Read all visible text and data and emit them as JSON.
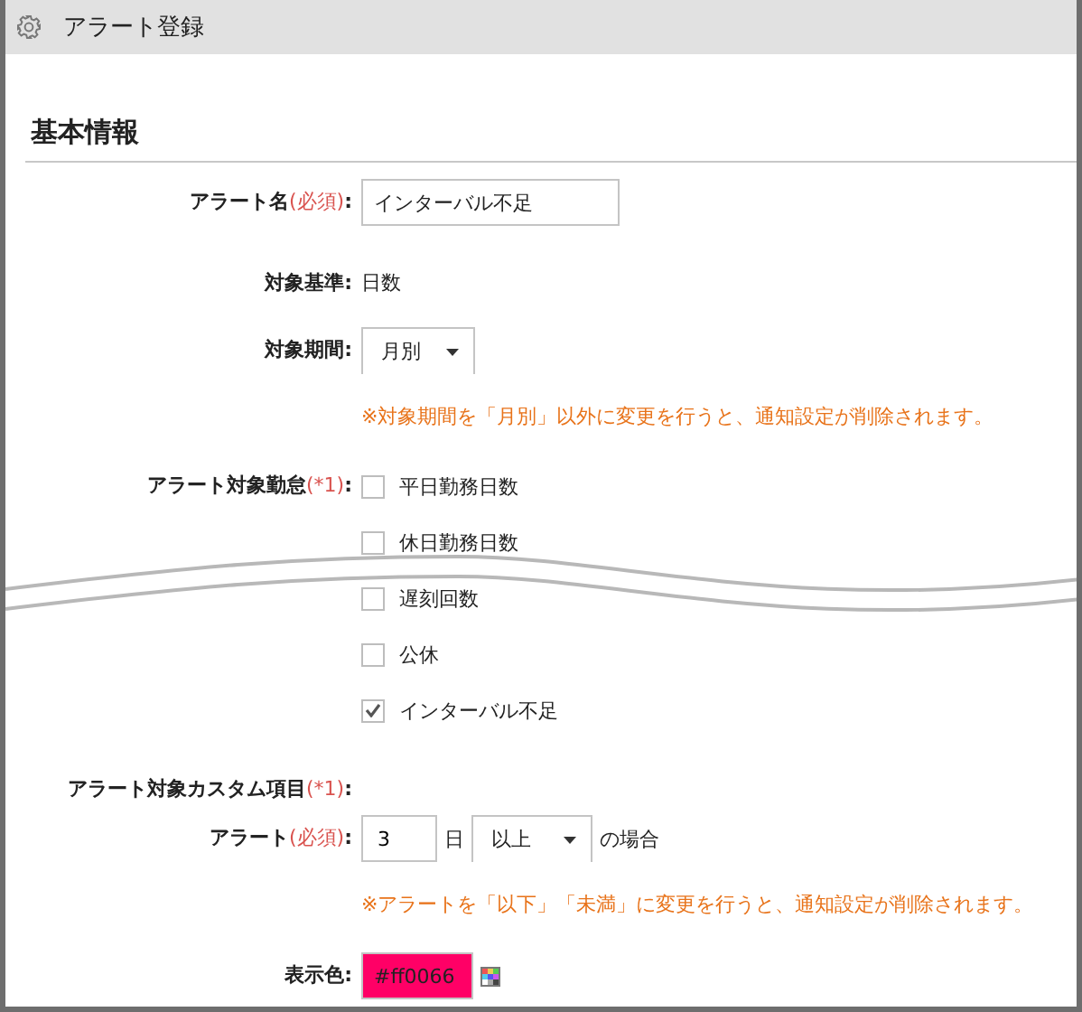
{
  "window": {
    "title": "アラート登録"
  },
  "section": {
    "title": "基本情報"
  },
  "rows": [
    {
      "kind": "input",
      "label": "アラート名",
      "required": "(必須)",
      "separator": ":",
      "value": "インターバル不足"
    },
    {
      "kind": "static",
      "label": "対象基準",
      "separator": ":",
      "value": "日数"
    },
    {
      "kind": "select",
      "label": "対象期間",
      "separator": ":",
      "value": "月別"
    },
    {
      "kind": "note",
      "text": "※対象期間を「月別」以外に変更を行うと、通知設定が削除されます。"
    },
    {
      "kind": "checkboxes",
      "label": "アラート対象勤怠",
      "required": "(*1)",
      "separator": ":",
      "options": [
        {
          "label": "平日勤務日数",
          "checked": false
        },
        {
          "label": "休日勤務日数",
          "checked": false
        },
        {
          "label": "遅刻回数",
          "checked": false
        },
        {
          "label": "公休",
          "checked": false
        },
        {
          "label": "インターバル不足",
          "checked": true
        }
      ]
    },
    {
      "kind": "heading",
      "label": "アラート対象カスタム項目",
      "required": "(*1)",
      "separator": ":"
    },
    {
      "kind": "condition",
      "label": "アラート",
      "required": "(必須)",
      "separator": ":",
      "value": "3",
      "unit": "日",
      "operator": "以上",
      "suffix": "の場合"
    },
    {
      "kind": "note",
      "text": "※アラートを「以下」「未満」に変更を行うと、通知設定が削除されます。"
    },
    {
      "kind": "color",
      "label": "表示色",
      "separator": ":",
      "value": "#ff0066"
    }
  ]
}
